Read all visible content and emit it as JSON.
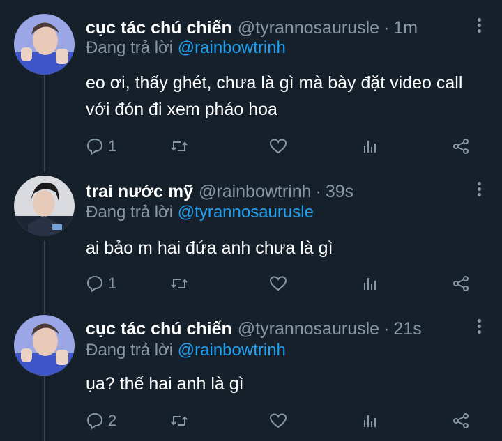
{
  "reply_prefix": "Đang trả lời",
  "tweets": [
    {
      "name": "cục tác chú chiến",
      "handle": "@tyrannosaurusle",
      "separator": "·",
      "time": "1m",
      "reply_to": "@rainbowtrinh",
      "text_lines": [
        "eo ơi, thấy ghét, chưa là gì mà bày đặt video call",
        "với đón đi xem pháo hoa"
      ],
      "reply_count": "1"
    },
    {
      "name": "trai nước mỹ",
      "handle": "@rainbowtrinh",
      "separator": "·",
      "time": "39s",
      "reply_to": "@tyrannosaurusle",
      "text_lines": [
        "ai bảo m hai đứa anh chưa là gì"
      ],
      "reply_count": "1"
    },
    {
      "name": "cục tác chú chiến",
      "handle": "@tyrannosaurusle",
      "separator": "·",
      "time": "21s",
      "reply_to": "@rainbowtrinh",
      "text_lines": [
        "ụa? thế hai anh là gì"
      ],
      "reply_count": "2"
    }
  ],
  "icons": {
    "reply": "reply-icon",
    "retweet": "retweet-icon",
    "like": "heart-icon",
    "analytics": "analytics-icon",
    "share": "share-icon",
    "more": "more-vertical-icon"
  },
  "colors": {
    "background": "#15202b",
    "secondary_text": "#8899a6",
    "mention": "#1da1f2",
    "thread_line": "#38444d"
  }
}
